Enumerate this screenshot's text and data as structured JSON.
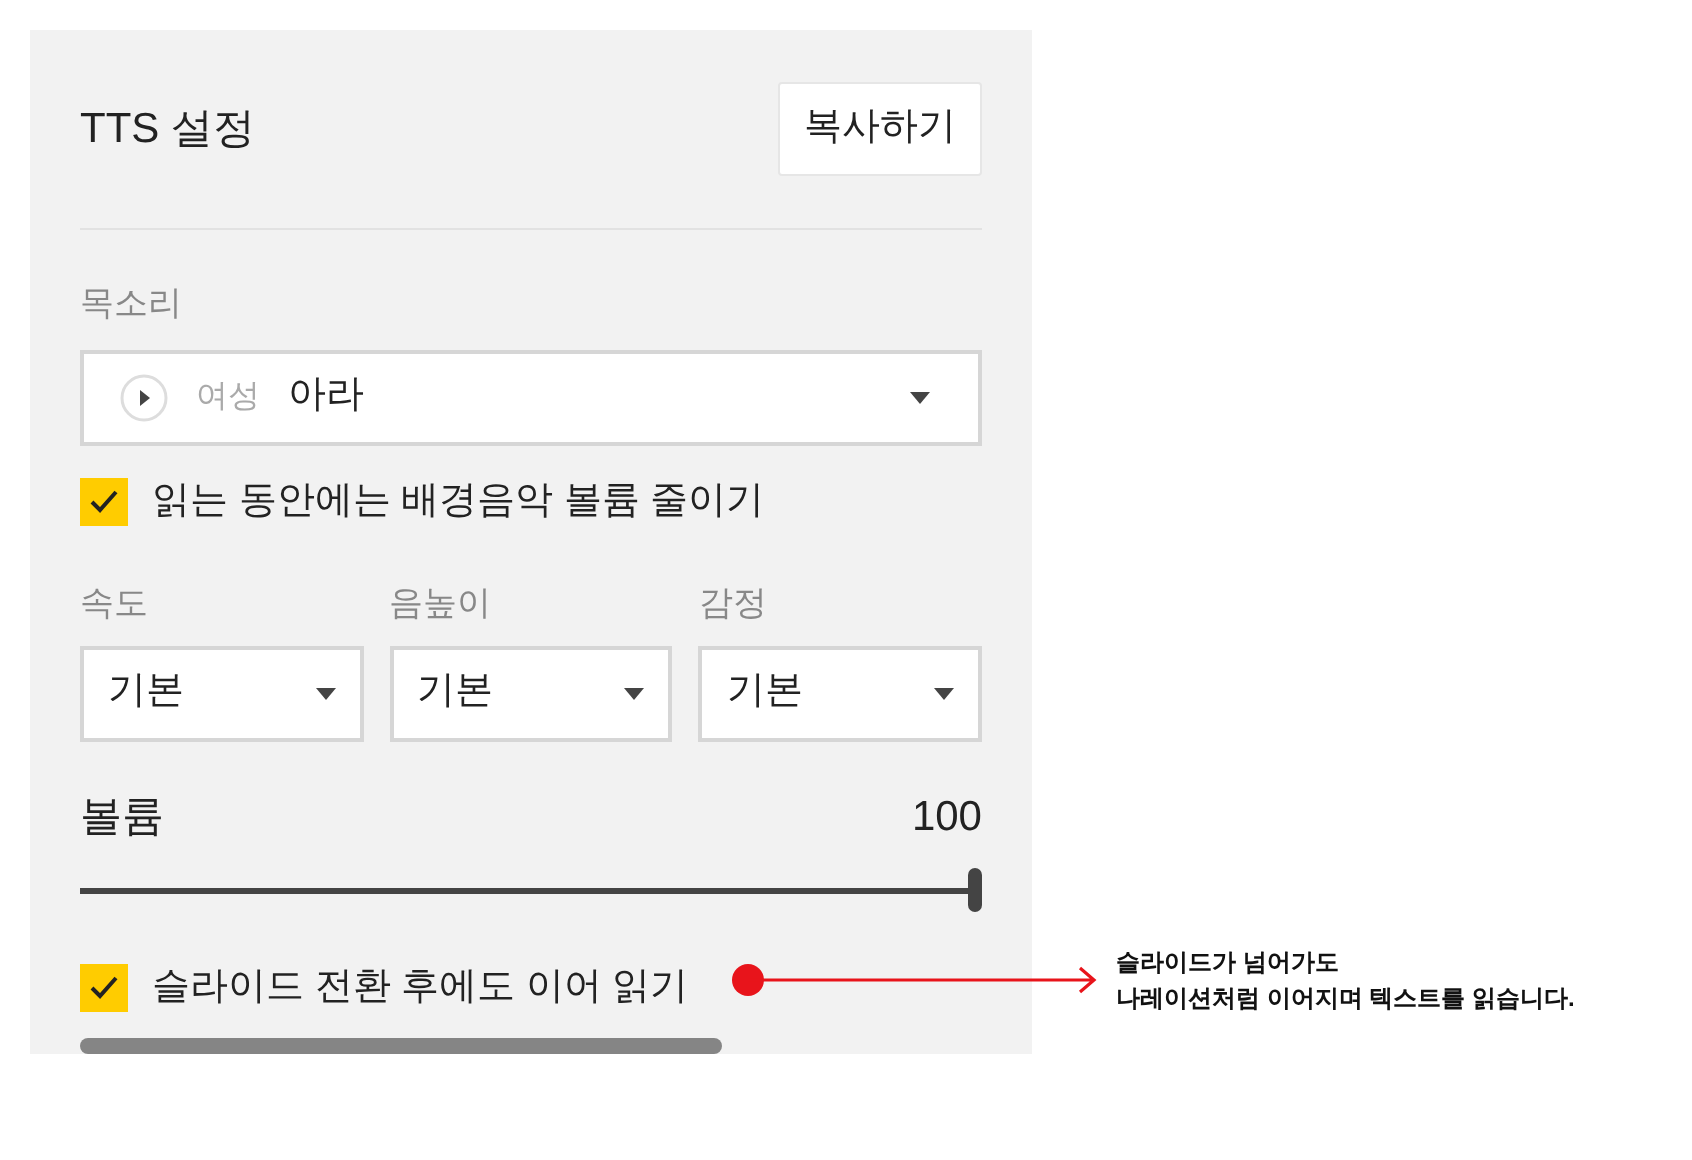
{
  "header": {
    "title": "TTS 설정",
    "copy_button": "복사하기"
  },
  "voice": {
    "label": "목소리",
    "gender": "여성",
    "name": "아라"
  },
  "duck_music": {
    "label": "읽는 동안에는 배경음악 볼륨 줄이기",
    "checked": true
  },
  "selects": [
    {
      "label": "속도",
      "value": "기본"
    },
    {
      "label": "음높이",
      "value": "기본"
    },
    {
      "label": "감정",
      "value": "기본"
    }
  ],
  "volume": {
    "label": "볼륨",
    "reading": "100",
    "level": 1
  },
  "continue_reading": {
    "label": "슬라이드 전환 후에도 이어 읽기",
    "checked": true
  },
  "annotation": {
    "text": "슬라이드가 넘어가도\n나레이션처럼 이어지며 텍스트를 읽습니다."
  }
}
